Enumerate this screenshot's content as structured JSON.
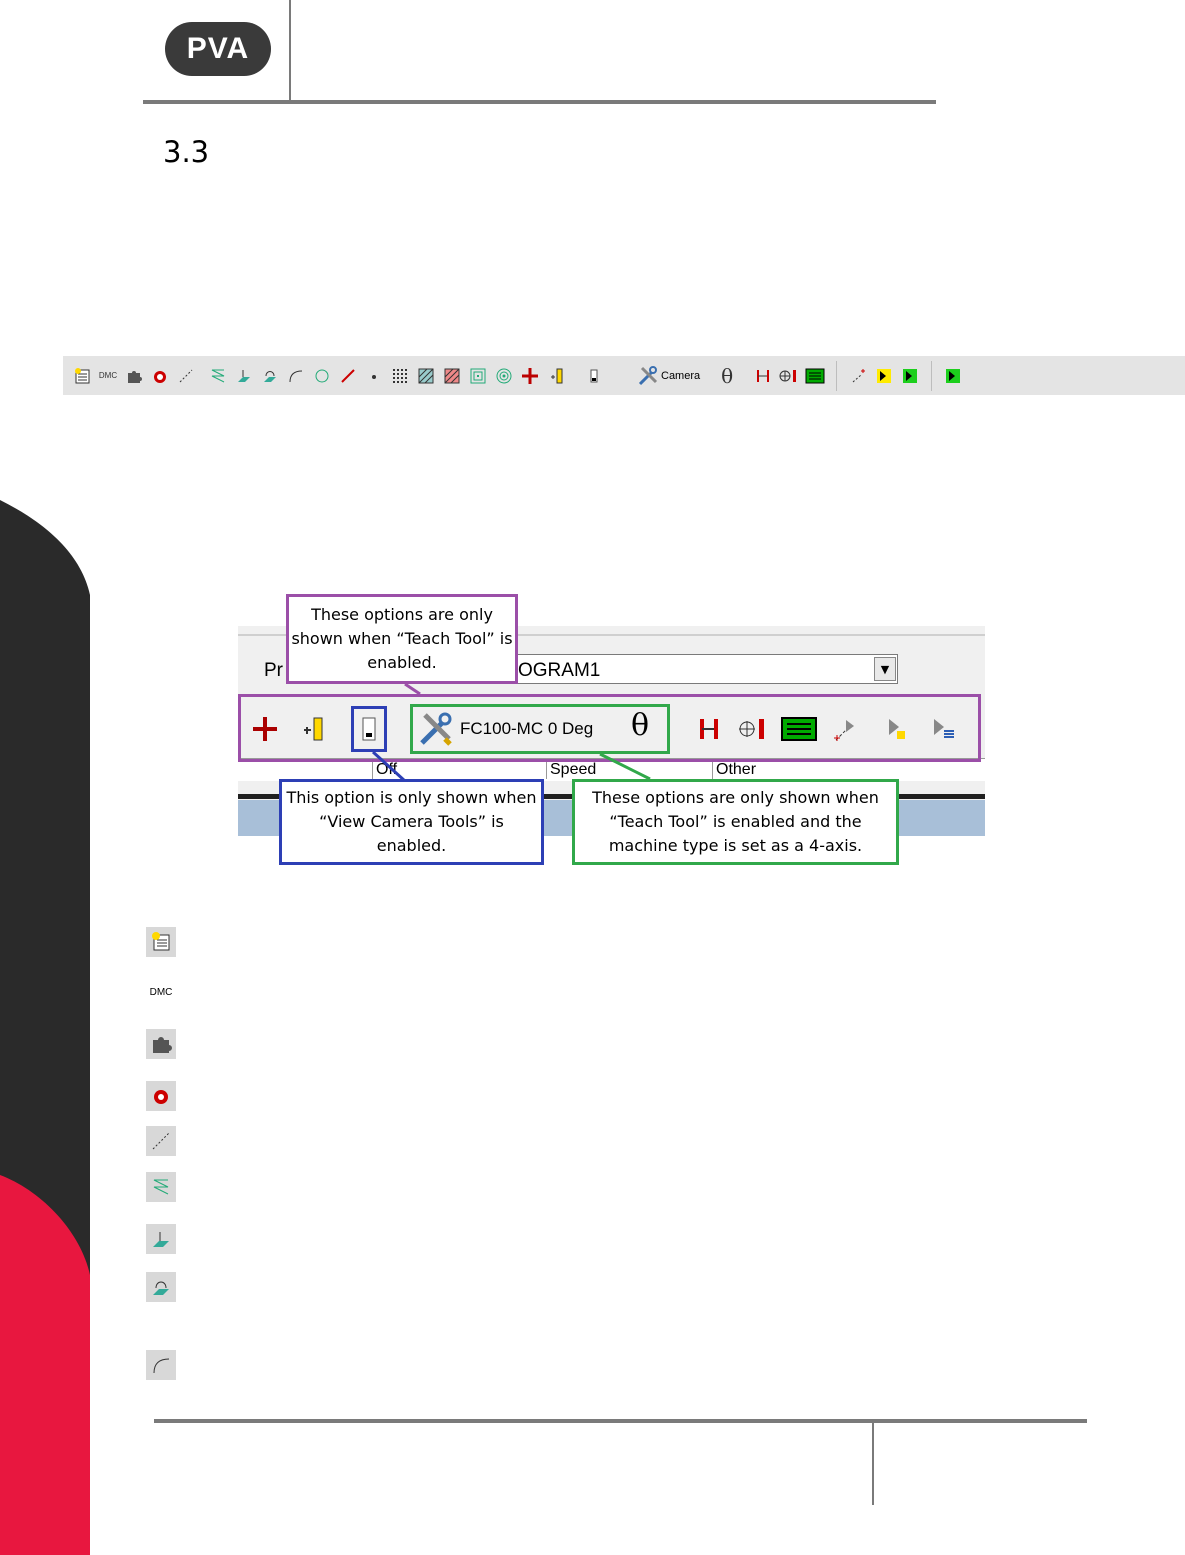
{
  "header": {
    "logo_text": "PVA",
    "section_number": "3.3"
  },
  "toolbar": {
    "items": [
      "program-icon",
      "dmc-icon",
      "puzzle-icon",
      "stop-icon",
      "dot-line-icon",
      "path-icon",
      "fill-area-icon",
      "area-path-icon",
      "arc-icon",
      "circle-icon",
      "line-icon",
      "dot-icon",
      "grid-icon",
      "hatch-blue-icon",
      "hatch-red-icon",
      "square-spiral-icon",
      "circle-spiral-icon",
      "red-cross-icon",
      "ruler-icon",
      "camera-tool-icon",
      "wrench-icon",
      "theta-icon",
      "teach-offset-icon",
      "crosshair-icon",
      "green-list-icon",
      "add-point-icon",
      "yellow-play-icon",
      "green-play-icon",
      "green-play-2-icon"
    ],
    "dmc_label": "DMC",
    "camera_label": "Camera",
    "theta_symbol": "θ"
  },
  "figure": {
    "program_label": "Pr",
    "program_value": "OGRAM1",
    "tool_label": "FC100-MC 0 Deg",
    "theta_symbol": "θ",
    "columns": [
      "Off",
      "Speed",
      "Other"
    ],
    "callouts": {
      "purple": "These options are only shown when “Teach Tool” is enabled.",
      "blue": "This option is only shown when “View Camera Tools” is enabled.",
      "green": "These options are only shown when “Teach Tool” is enabled and the machine type is set as a 4-axis."
    }
  },
  "icon_list": [
    "program-icon",
    "dmc-icon",
    "puzzle-icon",
    "stop-icon",
    "dot-line-icon",
    "path-icon",
    "fill-area-icon",
    "area-path-icon",
    "arc-icon"
  ],
  "colors": {
    "brand_red": "#e8173f",
    "brand_dark": "#2a2a2a",
    "callout_purple": "#9b4fa8",
    "callout_blue": "#2d3fb5",
    "callout_green": "#31a84a"
  }
}
